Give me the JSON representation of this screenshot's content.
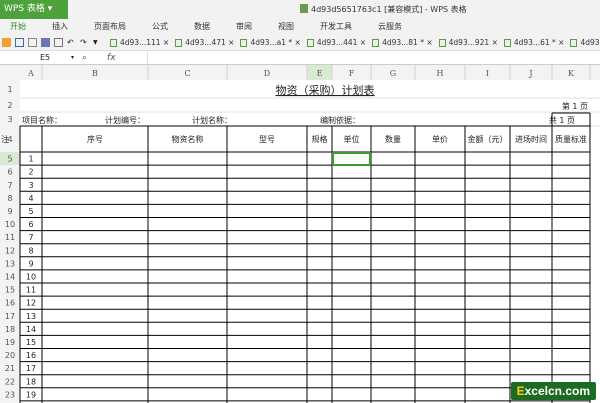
{
  "app": {
    "button": "WPS 表格",
    "title": "4d93d5651763c1 [兼容模式] - WPS 表格"
  },
  "menu": [
    "开始",
    "插入",
    "页面布局",
    "公式",
    "数据",
    "审阅",
    "视图",
    "开发工具",
    "云服务"
  ],
  "doc_tabs": [
    "4d93...111 ×",
    "4d93...471 ×",
    "4d93...a1 * ×",
    "4d93...441 ×",
    "4d93...81 * ×",
    "4d93...921 ×",
    "4d93...61 * ×",
    "4d93"
  ],
  "formula_bar": {
    "cell_ref": "E5",
    "fx": "fx",
    "value": ""
  },
  "columns": [
    "A",
    "B",
    "C",
    "D",
    "E",
    "F",
    "G",
    "H",
    "I",
    "J",
    "K"
  ],
  "selected_cell": "E5",
  "sheet": {
    "title": "物资（采购）计划表",
    "page_no": "第   1 页",
    "page_total": "共   1 页",
    "info": {
      "project": "项目名称：",
      "plan_no": "计划编号：",
      "plan_name": "计划名称：",
      "basis": "编制依据："
    },
    "headers": [
      "序号",
      "物资名称",
      "型号",
      "规格",
      "单位",
      "数量",
      "单价",
      "金额（元）",
      "进场时间",
      "质量标准",
      "备  注"
    ],
    "row_numbers": [
      1,
      2,
      3,
      4,
      5,
      6,
      7,
      8,
      9,
      10,
      11,
      12,
      13,
      14,
      15,
      16,
      17,
      18,
      19
    ],
    "seq": [
      "1",
      "2",
      "3",
      "4",
      "5",
      "6",
      "7",
      "8",
      "9",
      "10",
      "11",
      "12",
      "13",
      "14",
      "15",
      "16",
      "17",
      "18",
      "19"
    ]
  },
  "watermark": {
    "e": "E",
    "text": "xcelcn.com"
  }
}
